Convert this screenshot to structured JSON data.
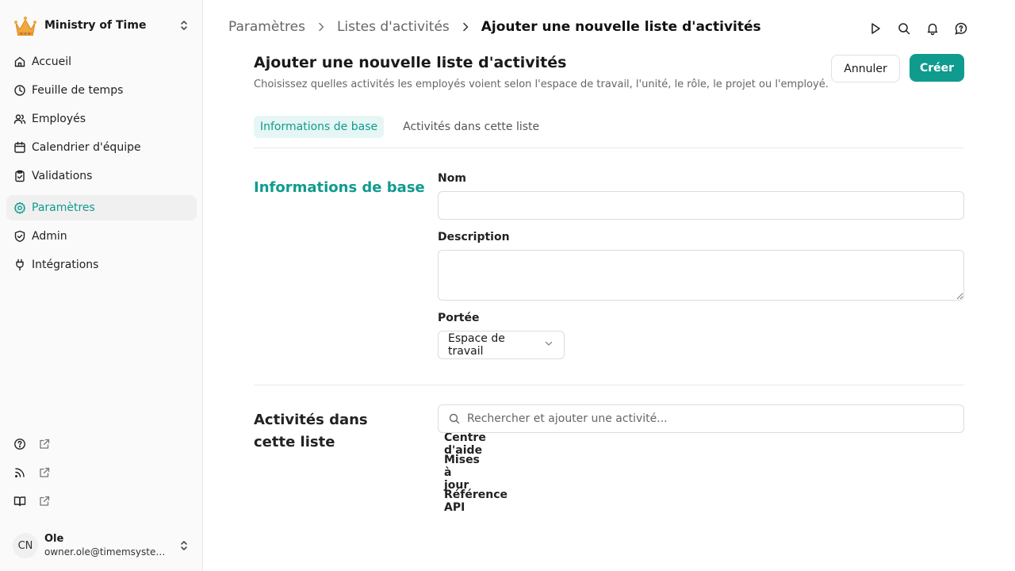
{
  "org": {
    "name": "Ministry of Time"
  },
  "nav": [
    {
      "label": "Accueil",
      "icon": "home-icon"
    },
    {
      "label": "Feuille de temps",
      "icon": "clock-icon"
    },
    {
      "label": "Employés",
      "icon": "users-icon"
    },
    {
      "label": "Calendrier d'équipe",
      "icon": "calendar-icon"
    },
    {
      "label": "Validations",
      "icon": "clipboard-check-icon"
    },
    {
      "label": "Paramètres",
      "icon": "gear-icon",
      "active": true
    },
    {
      "label": "Admin",
      "icon": "shield-icon"
    },
    {
      "label": "Intégrations",
      "icon": "plug-icon"
    }
  ],
  "bottom_nav": [
    {
      "label": "Centre d'aide",
      "icon": "help-circle-icon"
    },
    {
      "label": "Mises à jour",
      "icon": "rss-icon"
    },
    {
      "label": "Référence API",
      "icon": "book-icon"
    }
  ],
  "user": {
    "initials": "CN",
    "name": "Ole",
    "email": "owner.ole@timemsystem.com"
  },
  "breadcrumb": {
    "items": [
      "Paramètres",
      "Listes d'activités"
    ],
    "current": "Ajouter une nouvelle liste d'activités"
  },
  "header": {
    "title": "Ajouter une nouvelle liste d'activités",
    "subtitle": "Choisissez quelles activités les employés voient selon l'espace de travail, l'unité, le rôle, le projet ou l'employé.",
    "cancel_label": "Annuler",
    "create_label": "Créer"
  },
  "tabs": [
    {
      "label": "Informations de base",
      "active": true
    },
    {
      "label": "Activités dans cette liste",
      "active": false
    }
  ],
  "basic_info": {
    "title": "Informations de base",
    "name_label": "Nom",
    "name_value": "",
    "description_label": "Description",
    "description_value": "",
    "scope_label": "Portée",
    "scope_value": "Espace de travail"
  },
  "activities": {
    "title": "Activités dans cette liste",
    "search_placeholder": "Rechercher et ajouter une activité..."
  },
  "colors": {
    "accent": "#0f9b8e",
    "accent_bg": "#e6f6f4"
  }
}
